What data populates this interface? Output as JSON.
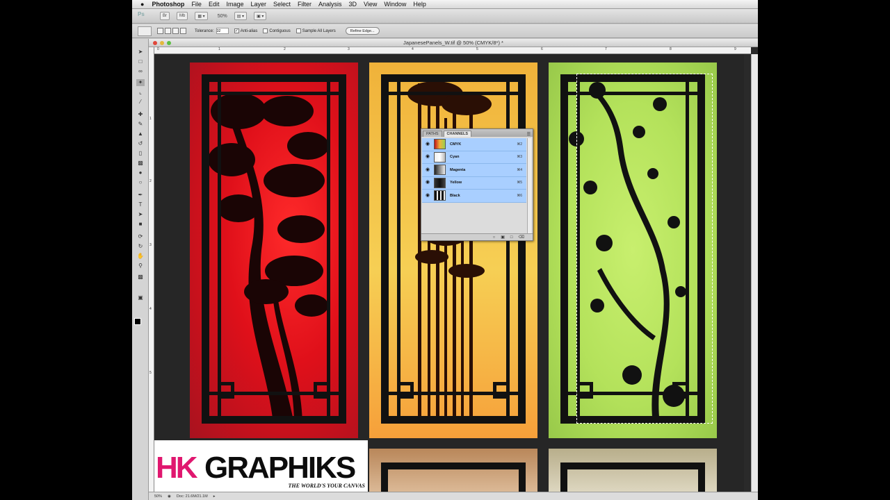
{
  "menubar": {
    "apple": "",
    "items": [
      "Photoshop",
      "File",
      "Edit",
      "Image",
      "Layer",
      "Select",
      "Filter",
      "Analysis",
      "3D",
      "View",
      "Window",
      "Help"
    ]
  },
  "appbar": {
    "app_icon": "Ps",
    "zoom": "50%"
  },
  "options": {
    "tolerance_label": "Tolerance:",
    "tolerance_value": "32",
    "anti_alias_label": "Anti-alias",
    "anti_alias_checked": true,
    "contiguous_label": "Contiguous",
    "contiguous_checked": false,
    "sample_all_label": "Sample All Layers",
    "sample_all_checked": false,
    "refine_edge_label": "Refine Edge..."
  },
  "document": {
    "title": "JapanesePanels_W.tif @ 50% (CMYK/8*) *",
    "ruler_h": [
      "0",
      "1",
      "2",
      "3",
      "4",
      "5",
      "6",
      "7",
      "8",
      "9"
    ],
    "ruler_v": [
      "1",
      "2",
      "3",
      "4",
      "5"
    ],
    "zoom_status": "50%",
    "doc_status": "Doc: 21.6M/21.1M"
  },
  "channels_panel": {
    "tabs": [
      "PATHS",
      "CHANNELS"
    ],
    "active_tab": "CHANNELS",
    "rows": [
      {
        "name": "CMYK",
        "shortcut": "⌘2"
      },
      {
        "name": "Cyan",
        "shortcut": "⌘3"
      },
      {
        "name": "Magenta",
        "shortcut": "⌘4"
      },
      {
        "name": "Yellow",
        "shortcut": "⌘5"
      },
      {
        "name": "Black",
        "shortcut": "⌘6"
      }
    ]
  },
  "logo": {
    "hk": "HK",
    "graphiks": "GRAPHIKS",
    "tagline": "THE WORLD'S YOUR CANVAS"
  },
  "colors": {
    "panel_red": "#e0101a",
    "panel_orange": "#f6cf54",
    "panel_green": "#b4e25b",
    "selection_blue": "#a9cfff",
    "logo_pink": "#e0176f"
  }
}
